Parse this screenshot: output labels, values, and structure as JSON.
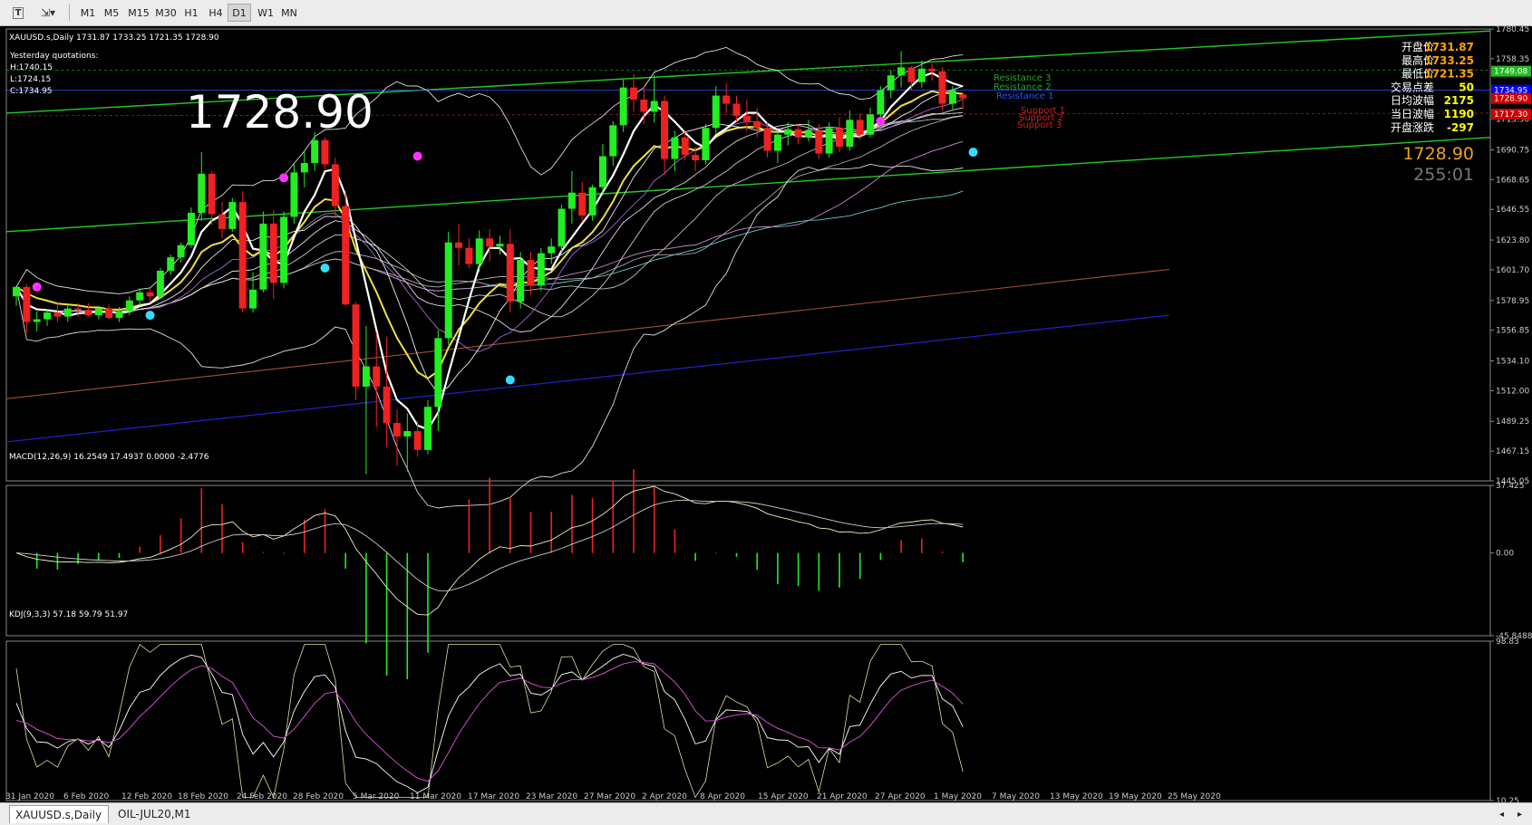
{
  "toolbar": {
    "timeframes": [
      {
        "label": "M1",
        "active": false
      },
      {
        "label": "M5",
        "active": false
      },
      {
        "label": "M15",
        "active": false
      },
      {
        "label": "M30",
        "active": false
      },
      {
        "label": "H1",
        "active": false
      },
      {
        "label": "H4",
        "active": false
      },
      {
        "label": "D1",
        "active": true
      },
      {
        "label": "W1",
        "active": false
      },
      {
        "label": "MN",
        "active": false
      }
    ]
  },
  "main_chart": {
    "header": "XAUUSD.s,Daily  1731.87 1733.25 1721.35 1728.90",
    "yesterday_title": "Yesterday quotations:",
    "yesterday_high": "H:1740.15",
    "yesterday_low": "L:1724.15",
    "yesterday_close": "C:1734.95",
    "big_price": "1728.90",
    "levels": [
      "Resistance 3",
      "Resistance 2",
      "Resistance 1",
      "Support 1",
      "Support 2",
      "Support 3"
    ],
    "info_panel": [
      {
        "label": "开盘价",
        "value": "1731.87",
        "color": "#ffa500"
      },
      {
        "label": "最高价",
        "value": "1733.25",
        "color": "#ffa500"
      },
      {
        "label": "最低价",
        "value": "1721.35",
        "color": "#ffa500"
      },
      {
        "label": "交易点差",
        "value": "50",
        "color": "#ffff00"
      },
      {
        "label": "日均波幅",
        "value": "2175",
        "color": "#ffff00"
      },
      {
        "label": "当日波幅",
        "value": "1190",
        "color": "#ffff00"
      },
      {
        "label": "开盘涨跌",
        "value": "-297",
        "color": "#ffff00"
      }
    ],
    "price_readout": "1728.90",
    "countdown": "255:01"
  },
  "price_axis": {
    "ticks": [
      "1780.45",
      "1758.35",
      "1735.80",
      "1713.50",
      "1690.75",
      "1668.65",
      "1646.55",
      "1623.80",
      "1601.70",
      "1578.95",
      "1556.85",
      "1534.10",
      "1512.00",
      "1489.25",
      "1467.15",
      "1445.05"
    ],
    "ylim": [
      1445.05,
      1780.45
    ],
    "badges": [
      {
        "label": "1749.08",
        "color": "#22bb22"
      },
      {
        "label": "1734.95",
        "color": "#0000ff"
      },
      {
        "label": "1728.90",
        "color": "#cc0000"
      },
      {
        "label": "1717.30",
        "color": "#cc0000"
      }
    ]
  },
  "macd": {
    "header": "MACD(12,26,9) 16.2549 17.4937 0.0000 -2.4776",
    "ticks": [
      "37.425",
      "0.00",
      "-45.8488"
    ],
    "ylim": [
      -45.8488,
      37.425
    ]
  },
  "kdj": {
    "header": "KDJ(9,3,3) 57.18 59.79 51.97",
    "ticks": [
      "98.83",
      "10.25"
    ],
    "ylim": [
      10.25,
      98.83
    ]
  },
  "time_axis": [
    "31 Jan 2020",
    "6 Feb 2020",
    "12 Feb 2020",
    "18 Feb 2020",
    "24 Feb 2020",
    "28 Feb 2020",
    "5 Mar 2020",
    "11 Mar 2020",
    "17 Mar 2020",
    "23 Mar 2020",
    "27 Mar 2020",
    "2 Apr 2020",
    "8 Apr 2020",
    "15 Apr 2020",
    "21 Apr 2020",
    "27 Apr 2020",
    "1 May 2020",
    "7 May 2020",
    "13 May 2020",
    "19 May 2020",
    "25 May 2020"
  ],
  "tabs": [
    {
      "label": "XAUUSD.s,Daily",
      "active": true
    },
    {
      "label": "OIL-JUL20,M1",
      "active": false
    }
  ],
  "chart_data": {
    "type": "candlestick",
    "title": "XAUUSD.s,Daily",
    "ylim": [
      1445.05,
      1780.45
    ],
    "candles": [
      {
        "o": 1582,
        "h": 1590,
        "l": 1575,
        "c": 1589
      },
      {
        "o": 1589,
        "h": 1591,
        "l": 1555,
        "c": 1563
      },
      {
        "o": 1563,
        "h": 1571,
        "l": 1556,
        "c": 1565
      },
      {
        "o": 1565,
        "h": 1572,
        "l": 1560,
        "c": 1570
      },
      {
        "o": 1570,
        "h": 1578,
        "l": 1563,
        "c": 1567
      },
      {
        "o": 1567,
        "h": 1576,
        "l": 1563,
        "c": 1573
      },
      {
        "o": 1573,
        "h": 1577,
        "l": 1567,
        "c": 1572
      },
      {
        "o": 1572,
        "h": 1577,
        "l": 1567,
        "c": 1568
      },
      {
        "o": 1568,
        "h": 1575,
        "l": 1565,
        "c": 1573
      },
      {
        "o": 1573,
        "h": 1576,
        "l": 1565,
        "c": 1566
      },
      {
        "o": 1566,
        "h": 1574,
        "l": 1563,
        "c": 1571
      },
      {
        "o": 1571,
        "h": 1582,
        "l": 1568,
        "c": 1579
      },
      {
        "o": 1579,
        "h": 1588,
        "l": 1575,
        "c": 1585
      },
      {
        "o": 1585,
        "h": 1588,
        "l": 1578,
        "c": 1582
      },
      {
        "o": 1582,
        "h": 1603,
        "l": 1580,
        "c": 1601
      },
      {
        "o": 1601,
        "h": 1613,
        "l": 1598,
        "c": 1611
      },
      {
        "o": 1611,
        "h": 1622,
        "l": 1607,
        "c": 1620
      },
      {
        "o": 1620,
        "h": 1648,
        "l": 1618,
        "c": 1644
      },
      {
        "o": 1644,
        "h": 1689,
        "l": 1638,
        "c": 1673
      },
      {
        "o": 1673,
        "h": 1675,
        "l": 1635,
        "c": 1643
      },
      {
        "o": 1643,
        "h": 1652,
        "l": 1625,
        "c": 1632
      },
      {
        "o": 1632,
        "h": 1655,
        "l": 1630,
        "c": 1652
      },
      {
        "o": 1652,
        "h": 1660,
        "l": 1570,
        "c": 1573
      },
      {
        "o": 1573,
        "h": 1600,
        "l": 1570,
        "c": 1587
      },
      {
        "o": 1587,
        "h": 1645,
        "l": 1585,
        "c": 1636
      },
      {
        "o": 1636,
        "h": 1646,
        "l": 1580,
        "c": 1592
      },
      {
        "o": 1592,
        "h": 1645,
        "l": 1588,
        "c": 1641
      },
      {
        "o": 1641,
        "h": 1680,
        "l": 1636,
        "c": 1674
      },
      {
        "o": 1674,
        "h": 1690,
        "l": 1663,
        "c": 1681
      },
      {
        "o": 1681,
        "h": 1704,
        "l": 1675,
        "c": 1698
      },
      {
        "o": 1698,
        "h": 1700,
        "l": 1676,
        "c": 1680
      },
      {
        "o": 1680,
        "h": 1685,
        "l": 1640,
        "c": 1649
      },
      {
        "o": 1649,
        "h": 1660,
        "l": 1575,
        "c": 1576
      },
      {
        "o": 1576,
        "h": 1578,
        "l": 1505,
        "c": 1515
      },
      {
        "o": 1515,
        "h": 1560,
        "l": 1450,
        "c": 1530
      },
      {
        "o": 1530,
        "h": 1555,
        "l": 1485,
        "c": 1515
      },
      {
        "o": 1515,
        "h": 1552,
        "l": 1470,
        "c": 1488
      },
      {
        "o": 1488,
        "h": 1498,
        "l": 1456,
        "c": 1478
      },
      {
        "o": 1478,
        "h": 1495,
        "l": 1452,
        "c": 1482
      },
      {
        "o": 1482,
        "h": 1490,
        "l": 1463,
        "c": 1468
      },
      {
        "o": 1468,
        "h": 1505,
        "l": 1465,
        "c": 1500
      },
      {
        "o": 1500,
        "h": 1557,
        "l": 1482,
        "c": 1551
      },
      {
        "o": 1551,
        "h": 1630,
        "l": 1546,
        "c": 1622
      },
      {
        "o": 1622,
        "h": 1636,
        "l": 1605,
        "c": 1618
      },
      {
        "o": 1618,
        "h": 1625,
        "l": 1603,
        "c": 1606
      },
      {
        "o": 1606,
        "h": 1631,
        "l": 1600,
        "c": 1625
      },
      {
        "o": 1625,
        "h": 1632,
        "l": 1608,
        "c": 1619
      },
      {
        "o": 1619,
        "h": 1627,
        "l": 1613,
        "c": 1621
      },
      {
        "o": 1621,
        "h": 1632,
        "l": 1570,
        "c": 1578
      },
      {
        "o": 1578,
        "h": 1615,
        "l": 1573,
        "c": 1609
      },
      {
        "o": 1609,
        "h": 1615,
        "l": 1583,
        "c": 1590
      },
      {
        "o": 1590,
        "h": 1618,
        "l": 1586,
        "c": 1614
      },
      {
        "o": 1614,
        "h": 1625,
        "l": 1606,
        "c": 1619
      },
      {
        "o": 1619,
        "h": 1650,
        "l": 1614,
        "c": 1647
      },
      {
        "o": 1647,
        "h": 1675,
        "l": 1636,
        "c": 1659
      },
      {
        "o": 1659,
        "h": 1667,
        "l": 1637,
        "c": 1642
      },
      {
        "o": 1642,
        "h": 1665,
        "l": 1638,
        "c": 1663
      },
      {
        "o": 1663,
        "h": 1695,
        "l": 1657,
        "c": 1686
      },
      {
        "o": 1686,
        "h": 1712,
        "l": 1679,
        "c": 1709
      },
      {
        "o": 1709,
        "h": 1743,
        "l": 1704,
        "c": 1737
      },
      {
        "o": 1737,
        "h": 1747,
        "l": 1719,
        "c": 1728
      },
      {
        "o": 1728,
        "h": 1738,
        "l": 1710,
        "c": 1719
      },
      {
        "o": 1719,
        "h": 1746,
        "l": 1711,
        "c": 1727
      },
      {
        "o": 1727,
        "h": 1731,
        "l": 1672,
        "c": 1684
      },
      {
        "o": 1684,
        "h": 1705,
        "l": 1675,
        "c": 1700
      },
      {
        "o": 1700,
        "h": 1705,
        "l": 1683,
        "c": 1687
      },
      {
        "o": 1687,
        "h": 1693,
        "l": 1675,
        "c": 1683
      },
      {
        "o": 1683,
        "h": 1710,
        "l": 1680,
        "c": 1707
      },
      {
        "o": 1707,
        "h": 1738,
        "l": 1703,
        "c": 1731
      },
      {
        "o": 1731,
        "h": 1740,
        "l": 1718,
        "c": 1725
      },
      {
        "o": 1725,
        "h": 1731,
        "l": 1712,
        "c": 1716
      },
      {
        "o": 1716,
        "h": 1728,
        "l": 1704,
        "c": 1712
      },
      {
        "o": 1712,
        "h": 1722,
        "l": 1700,
        "c": 1707
      },
      {
        "o": 1707,
        "h": 1711,
        "l": 1685,
        "c": 1690
      },
      {
        "o": 1690,
        "h": 1706,
        "l": 1681,
        "c": 1702
      },
      {
        "o": 1702,
        "h": 1711,
        "l": 1694,
        "c": 1706
      },
      {
        "o": 1706,
        "h": 1710,
        "l": 1695,
        "c": 1700
      },
      {
        "o": 1700,
        "h": 1713,
        "l": 1697,
        "c": 1705
      },
      {
        "o": 1705,
        "h": 1710,
        "l": 1684,
        "c": 1688
      },
      {
        "o": 1688,
        "h": 1711,
        "l": 1685,
        "c": 1707
      },
      {
        "o": 1707,
        "h": 1715,
        "l": 1689,
        "c": 1693
      },
      {
        "o": 1693,
        "h": 1720,
        "l": 1690,
        "c": 1713
      },
      {
        "o": 1713,
        "h": 1718,
        "l": 1698,
        "c": 1702
      },
      {
        "o": 1702,
        "h": 1722,
        "l": 1700,
        "c": 1717
      },
      {
        "o": 1717,
        "h": 1738,
        "l": 1715,
        "c": 1735
      },
      {
        "o": 1735,
        "h": 1750,
        "l": 1729,
        "c": 1746
      },
      {
        "o": 1746,
        "h": 1764,
        "l": 1737,
        "c": 1752
      },
      {
        "o": 1752,
        "h": 1753,
        "l": 1735,
        "c": 1741
      },
      {
        "o": 1741,
        "h": 1757,
        "l": 1737,
        "c": 1751
      },
      {
        "o": 1751,
        "h": 1755,
        "l": 1742,
        "c": 1749
      },
      {
        "o": 1749,
        "h": 1752,
        "l": 1720,
        "c": 1725
      },
      {
        "o": 1725,
        "h": 1738,
        "l": 1721,
        "c": 1735
      },
      {
        "o": 1731.87,
        "h": 1733.25,
        "l": 1721.35,
        "c": 1728.9
      }
    ],
    "indicators": [
      "MACD(12,26,9)",
      "KDJ(9,3,3)"
    ]
  }
}
